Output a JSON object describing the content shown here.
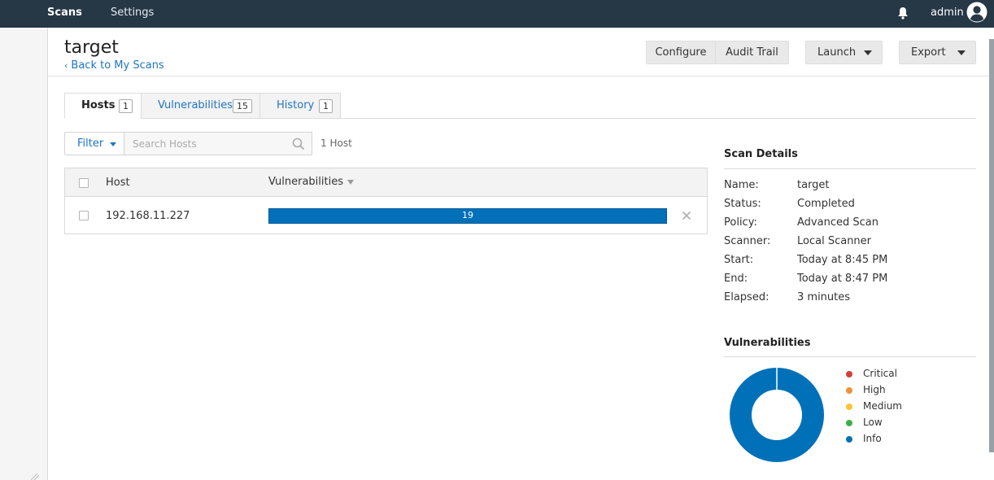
{
  "nav": {
    "scans": "Scans",
    "settings": "Settings",
    "user": "admin"
  },
  "header": {
    "title": "target",
    "back_link": "Back to My Scans",
    "buttons": {
      "configure": "Configure",
      "audit_trail": "Audit Trail",
      "launch": "Launch",
      "export": "Export"
    }
  },
  "tabs": [
    {
      "label": "Hosts",
      "count": "1",
      "active": true
    },
    {
      "label": "Vulnerabilities",
      "count": "15",
      "active": false
    },
    {
      "label": "History",
      "count": "1",
      "active": false
    }
  ],
  "filter": {
    "label": "Filter",
    "search_placeholder": "Search Hosts",
    "result_count": "1 Host"
  },
  "table": {
    "columns": [
      "Host",
      "Vulnerabilities"
    ],
    "rows": [
      {
        "host": "192.168.11.227",
        "vulnerabilities": "19",
        "info_fraction": 1.0
      }
    ]
  },
  "scan_details": {
    "title": "Scan Details",
    "fields": [
      {
        "key": "Name:",
        "value": "target"
      },
      {
        "key": "Status:",
        "value": "Completed"
      },
      {
        "key": "Policy:",
        "value": "Advanced Scan"
      },
      {
        "key": "Scanner:",
        "value": "Local Scanner"
      },
      {
        "key": "Start:",
        "value": "Today at 8:45 PM"
      },
      {
        "key": "End:",
        "value": "Today at 8:47 PM"
      },
      {
        "key": "Elapsed:",
        "value": "3 minutes"
      }
    ]
  },
  "vulnerabilities": {
    "title": "Vulnerabilities",
    "legend": [
      {
        "label": "Critical",
        "color": "#d43f3a"
      },
      {
        "label": "High",
        "color": "#ee9336"
      },
      {
        "label": "Medium",
        "color": "#fdc431"
      },
      {
        "label": "Low",
        "color": "#3fae49"
      },
      {
        "label": "Info",
        "color": "#0071b9"
      }
    ],
    "distribution": {
      "Critical": 0,
      "High": 0,
      "Medium": 0,
      "Low": 0,
      "Info": 19
    }
  },
  "icons": {
    "bell": "bell-icon",
    "avatar": "user-avatar-icon",
    "search": "search-icon",
    "remove": "close-icon",
    "back": "chevron-left-icon"
  }
}
